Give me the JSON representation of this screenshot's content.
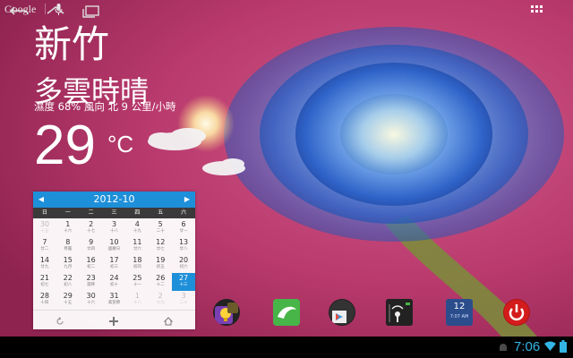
{
  "search": {
    "label": "Google"
  },
  "weather": {
    "city": "新竹",
    "condition": "多雲時晴",
    "details": "濕度 68% 風向 北 9 公里/小時",
    "temperature": "29",
    "unit": "°C"
  },
  "calendar": {
    "month": "2012-10",
    "weekdays": [
      "日",
      "一",
      "二",
      "三",
      "四",
      "五",
      "六"
    ],
    "weeks": [
      [
        {
          "d": "30",
          "l": "十五",
          "other": true
        },
        {
          "d": "1",
          "l": "十六"
        },
        {
          "d": "2",
          "l": "十七"
        },
        {
          "d": "3",
          "l": "十八"
        },
        {
          "d": "4",
          "l": "十九"
        },
        {
          "d": "5",
          "l": "二十"
        },
        {
          "d": "6",
          "l": "廿一"
        }
      ],
      [
        {
          "d": "7",
          "l": "廿二"
        },
        {
          "d": "8",
          "l": "寒露"
        },
        {
          "d": "9",
          "l": "廿四"
        },
        {
          "d": "10",
          "l": "國慶日"
        },
        {
          "d": "11",
          "l": "廿六"
        },
        {
          "d": "12",
          "l": "廿七"
        },
        {
          "d": "13",
          "l": "廿八"
        }
      ],
      [
        {
          "d": "14",
          "l": "廿九"
        },
        {
          "d": "15",
          "l": "九月"
        },
        {
          "d": "16",
          "l": "初二"
        },
        {
          "d": "17",
          "l": "初三"
        },
        {
          "d": "18",
          "l": "初四"
        },
        {
          "d": "19",
          "l": "初五"
        },
        {
          "d": "20",
          "l": "初六"
        }
      ],
      [
        {
          "d": "21",
          "l": "初七"
        },
        {
          "d": "22",
          "l": "初八"
        },
        {
          "d": "23",
          "l": "霜降"
        },
        {
          "d": "24",
          "l": "初十"
        },
        {
          "d": "25",
          "l": "十一"
        },
        {
          "d": "26",
          "l": "十二"
        },
        {
          "d": "27",
          "l": "十三",
          "today": true
        }
      ],
      [
        {
          "d": "28",
          "l": "十四"
        },
        {
          "d": "29",
          "l": "十五"
        },
        {
          "d": "30",
          "l": "十六"
        },
        {
          "d": "31",
          "l": "萬聖節"
        },
        {
          "d": "1",
          "l": "十八",
          "other": true
        },
        {
          "d": "2",
          "l": "十九",
          "other": true
        },
        {
          "d": "3",
          "l": "二十",
          "other": true
        }
      ]
    ]
  },
  "dock": {
    "widget_date": "12",
    "widget_time": "7:07 AM"
  },
  "status": {
    "time": "7:06"
  },
  "colors": {
    "accent": "#1e8fd9",
    "clock": "#33b5e5",
    "wallpaper": "#c23d73",
    "flower": "#3a78d8"
  }
}
